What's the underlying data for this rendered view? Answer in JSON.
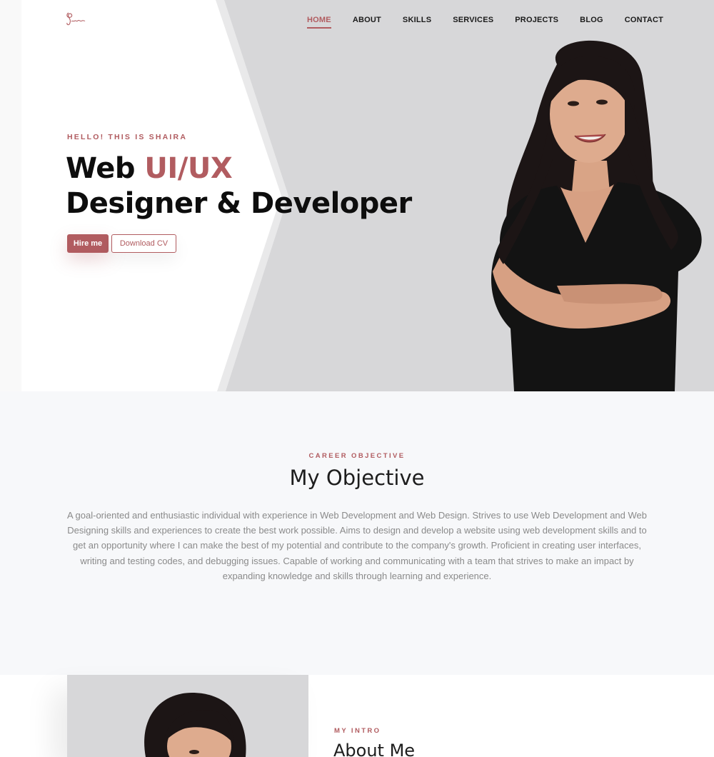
{
  "nav": {
    "logo_text": "Shaira",
    "items": [
      {
        "label": "HOME",
        "active": true
      },
      {
        "label": "ABOUT",
        "active": false
      },
      {
        "label": "SKILLS",
        "active": false
      },
      {
        "label": "SERVICES",
        "active": false
      },
      {
        "label": "PROJECTS",
        "active": false
      },
      {
        "label": "BLOG",
        "active": false
      },
      {
        "label": "CONTACT",
        "active": false
      }
    ]
  },
  "hero": {
    "kicker": "HELLO! THIS IS SHAIRA",
    "title_part1": "Web ",
    "title_accent": "UI/UX",
    "title_line2": "Designer & Developer",
    "hire_label": "Hire me",
    "cv_label": "Download CV"
  },
  "objective": {
    "kicker": "CAREER OBJECTIVE",
    "title": "My Objective",
    "text": "A goal-oriented and enthusiastic individual with experience in Web Development and Web Design. Strives to use Web Development and Web Designing skills and experiences to create the best work possible. Aims to design and develop a website using web development skills and to get an opportunity where I can make the best of my potential and contribute to the company's growth. Proficient in creating user interfaces, writing and testing codes, and debugging issues. Capable of working and communicating with a team that strives to make an impact by expanding knowledge and skills through learning and experience."
  },
  "about": {
    "kicker": "MY INTRO",
    "title": "About Me"
  },
  "colors": {
    "accent": "#b15c60",
    "hero_gray": "#d7d7d9",
    "section_bg": "#f7f8fa"
  }
}
